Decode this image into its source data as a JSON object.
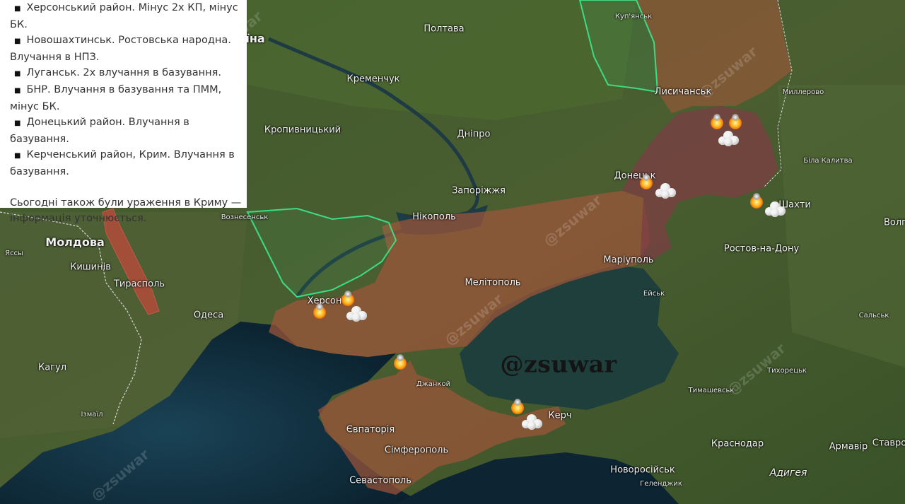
{
  "panel": {
    "items": [
      "Херсонський район. Мінус 2х КП, мінус БК.",
      "Новошахтинськ. Ростовська народна. Влучання в НПЗ.",
      "Луганськ. 2х влучання в базування.",
      "БНР. Влучання в базування та ПММ, мінус БК.",
      "Донецький район. Влучання в базування.",
      "Керченський район, Крим. Влучання в базування."
    ],
    "bullet_glyph": "■",
    "note": "Сьогодні також були ураження в Криму — інформація уточнюється."
  },
  "watermark": "@zsuwar",
  "faint_watermark": "@zsuwar",
  "colors": {
    "occupied": "#a0563a",
    "dprlpr": "#7c3d44",
    "liberated_outline": "#3ddc84",
    "transnistria": "#b84a3a",
    "sea_deep": "#102838",
    "sea_azov": "#1f3f3c"
  },
  "map": {
    "places": [
      {
        "id": "ukraine",
        "name": "їна",
        "type": "country"
      },
      {
        "id": "poltava",
        "name": "Полтава",
        "type": "major"
      },
      {
        "id": "kupiansk",
        "name": "Куп'янськ",
        "type": "minor"
      },
      {
        "id": "kremenchuk",
        "name": "Кременчук",
        "type": "major"
      },
      {
        "id": "lysychansk",
        "name": "Лисичанськ",
        "type": "major"
      },
      {
        "id": "millerovo",
        "name": "Миллерово",
        "type": "minor"
      },
      {
        "id": "kropyvnytskyi",
        "name": "Кропивницький",
        "type": "major"
      },
      {
        "id": "dnipro",
        "name": "Дніпро",
        "type": "major"
      },
      {
        "id": "bila-kalytva",
        "name": "Біла Калитва",
        "type": "minor"
      },
      {
        "id": "donetsk",
        "name": "Донецьк",
        "type": "major"
      },
      {
        "id": "zaporizhzhia",
        "name": "Запоріжжя",
        "type": "major"
      },
      {
        "id": "shakhty",
        "name": "Шахти",
        "type": "major"
      },
      {
        "id": "voznesensk",
        "name": "Вознесенськ",
        "type": "minor"
      },
      {
        "id": "nikopol",
        "name": "Нікополь",
        "type": "major"
      },
      {
        "id": "volgodonsk",
        "name": "Волг",
        "type": "major"
      },
      {
        "id": "moldova",
        "name": "Молдова",
        "type": "country"
      },
      {
        "id": "iasi",
        "name": "Яссы",
        "type": "minor"
      },
      {
        "id": "chisinau",
        "name": "Кишинів",
        "type": "major"
      },
      {
        "id": "mariupol",
        "name": "Маріуполь",
        "type": "major"
      },
      {
        "id": "rostov",
        "name": "Ростов-на-Дону",
        "type": "major"
      },
      {
        "id": "tiraspol",
        "name": "Тирасполь",
        "type": "major"
      },
      {
        "id": "melitopol",
        "name": "Мелітополь",
        "type": "major"
      },
      {
        "id": "yeysk",
        "name": "Ейськ",
        "type": "minor"
      },
      {
        "id": "odesa",
        "name": "Одеса",
        "type": "major"
      },
      {
        "id": "kherson",
        "name": "Херсон",
        "type": "major"
      },
      {
        "id": "salsk",
        "name": "Сальськ",
        "type": "minor"
      },
      {
        "id": "tikhoretsk",
        "name": "Тихорецьк",
        "type": "minor"
      },
      {
        "id": "cahul",
        "name": "Кагул",
        "type": "major"
      },
      {
        "id": "dzhankoi",
        "name": "Джанкой",
        "type": "minor"
      },
      {
        "id": "timashevsk",
        "name": "Тимашевськ",
        "type": "minor"
      },
      {
        "id": "izmail",
        "name": "Ізмаїл",
        "type": "minor"
      },
      {
        "id": "kerch",
        "name": "Керч",
        "type": "major"
      },
      {
        "id": "yevpatoria",
        "name": "Євпаторія",
        "type": "major"
      },
      {
        "id": "krasnodar",
        "name": "Краснодар",
        "type": "major"
      },
      {
        "id": "armavir",
        "name": "Армавір",
        "type": "major"
      },
      {
        "id": "stavropol",
        "name": "Ставро",
        "type": "major"
      },
      {
        "id": "simferopol",
        "name": "Сімферополь",
        "type": "major"
      },
      {
        "id": "adygea",
        "name": "Адигея",
        "type": "italic"
      },
      {
        "id": "novorossiysk",
        "name": "Новоросійськ",
        "type": "major"
      },
      {
        "id": "sevastopol",
        "name": "Севастополь",
        "type": "major"
      },
      {
        "id": "gelendzhik",
        "name": "Геленджик",
        "type": "minor"
      }
    ],
    "strikes": [
      {
        "id": "luhansk-strike",
        "near": "Луганськ",
        "smoke": true
      },
      {
        "id": "donetsk-strike",
        "near": "Донецьк",
        "smoke": true
      },
      {
        "id": "shakhty-strike",
        "near": "Шахти",
        "smoke": true
      },
      {
        "id": "kherson-strike",
        "near": "Херсон",
        "smoke": true
      },
      {
        "id": "dzhankoi-strike",
        "near": "Джанкой",
        "smoke": false
      },
      {
        "id": "kerch-strike",
        "near": "Керч",
        "smoke": true
      }
    ]
  }
}
